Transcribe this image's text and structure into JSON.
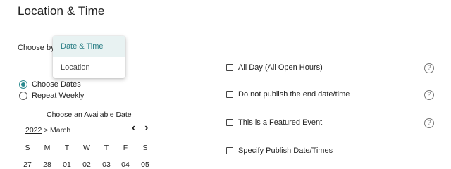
{
  "section": {
    "title": "Location & Time"
  },
  "choose_by": {
    "label": "Choose by",
    "options": [
      "Date & Time",
      "Location"
    ],
    "selected": "Date & Time"
  },
  "date_mode": {
    "options": [
      {
        "label": "Choose Dates",
        "checked": true
      },
      {
        "label": "Repeat Weekly",
        "checked": false
      }
    ]
  },
  "calendar": {
    "title": "Choose an Available Date",
    "year": "2022",
    "month": "> March",
    "prev_icon": "chevron-left-icon",
    "next_icon": "chevron-right-icon",
    "weekdays": [
      "S",
      "M",
      "T",
      "W",
      "T",
      "F",
      "S"
    ],
    "days": [
      "27",
      "28",
      "01",
      "02",
      "03",
      "04",
      "05"
    ]
  },
  "options": [
    {
      "label": "All Day (All Open Hours)",
      "checked": false,
      "help": true
    },
    {
      "label": "Do not publish the end date/time",
      "checked": false,
      "help": true
    },
    {
      "label": "This is a Featured Event",
      "checked": false,
      "help": true
    },
    {
      "label": "Specify Publish Date/Times",
      "checked": false,
      "help": false
    }
  ],
  "colors": {
    "accent": "#2b8a8f",
    "selected_bg": "#e8f2f2"
  }
}
